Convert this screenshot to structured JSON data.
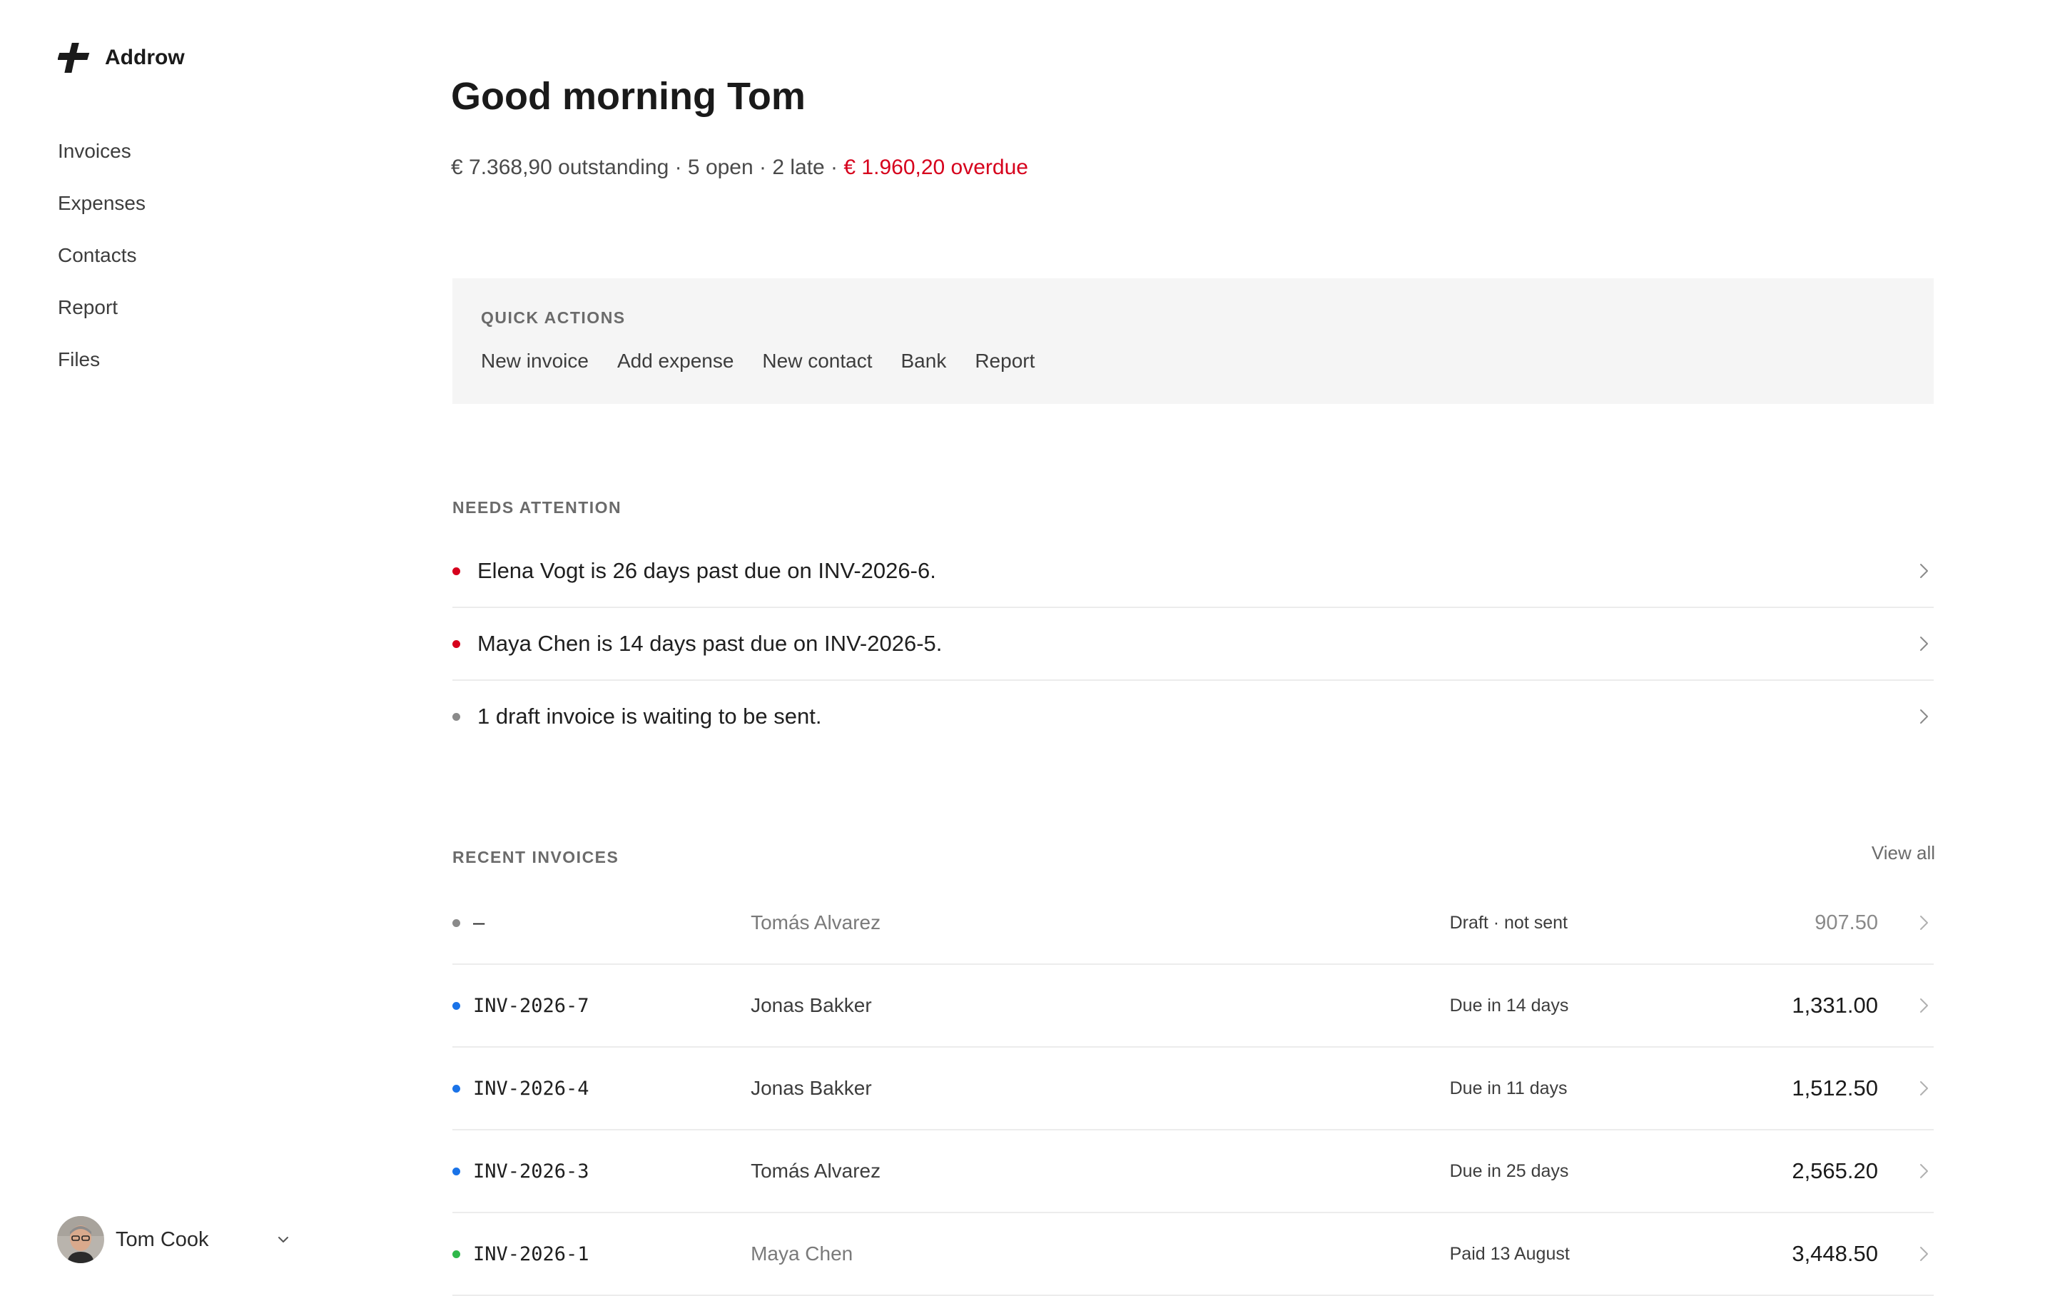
{
  "brand": {
    "name": "Addrow"
  },
  "nav": {
    "items": [
      {
        "label": "Invoices"
      },
      {
        "label": "Expenses"
      },
      {
        "label": "Contacts"
      },
      {
        "label": "Report"
      },
      {
        "label": "Files"
      }
    ]
  },
  "user": {
    "name": "Tom Cook"
  },
  "header": {
    "greeting": "Good morning Tom",
    "summary": "€ 7.368,90 outstanding · 5 open · 2 late ·",
    "overdue": "€ 1.960,20 overdue"
  },
  "quick_actions": {
    "label": "QUICK ACTIONS",
    "items": [
      "New invoice",
      "Add expense",
      "New contact",
      "Bank",
      "Report"
    ]
  },
  "needs_attention": {
    "label": "NEEDS ATTENTION",
    "items": [
      {
        "text": "Elena Vogt is 26 days past due on INV-2026-6.",
        "status": "overdue"
      },
      {
        "text": "Maya Chen is 14 days past due on INV-2026-5.",
        "status": "overdue"
      },
      {
        "text": "1 draft invoice is waiting to be sent.",
        "status": "draft"
      }
    ]
  },
  "recent_invoices": {
    "label": "RECENT INVOICES",
    "view_all": "View all",
    "rows": [
      {
        "number": "–",
        "contact": "Tomás Alvarez",
        "status": "Draft · not sent",
        "amount": "907.50",
        "state": "draft"
      },
      {
        "number": "INV-2026-7",
        "contact": "Jonas Bakker",
        "status": "Due in 14 days",
        "amount": "1,331.00",
        "state": "open"
      },
      {
        "number": "INV-2026-4",
        "contact": "Jonas Bakker",
        "status": "Due in 11 days",
        "amount": "1,512.50",
        "state": "open"
      },
      {
        "number": "INV-2026-3",
        "contact": "Tomás Alvarez",
        "status": "Due in 25 days",
        "amount": "2,565.20",
        "state": "open"
      },
      {
        "number": "INV-2026-1",
        "contact": "Maya Chen",
        "status": "Paid 13 August",
        "amount": "3,448.50",
        "state": "paid"
      }
    ]
  },
  "colors": {
    "overdue": "#d6001c",
    "draft": "#8a8a8a",
    "open": "#1a73e8",
    "paid": "#2fb84a",
    "panel_bg": "#f5f5f5"
  },
  "icons": {
    "logo": "addrow-logo-icon",
    "chevron_right": "chevron-right-icon",
    "chevron_down": "chevron-down-icon"
  }
}
